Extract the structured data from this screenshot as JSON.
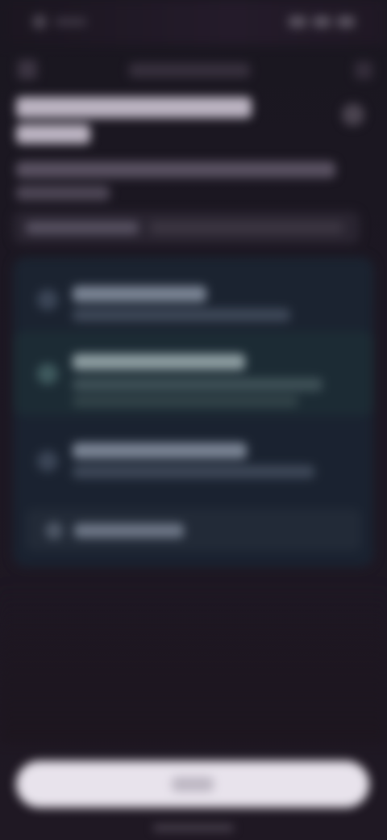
{
  "colors": {
    "background": "#1d161f",
    "card_background": "#1b2330",
    "selected_option": "#1c2b34",
    "primary_button": "#e8e3ec"
  },
  "icons": {
    "back": "arrow-left-icon",
    "menu": "more-vert-icon",
    "close": "close-icon",
    "option_bullet": "radio-icon",
    "footer": "info-icon"
  }
}
